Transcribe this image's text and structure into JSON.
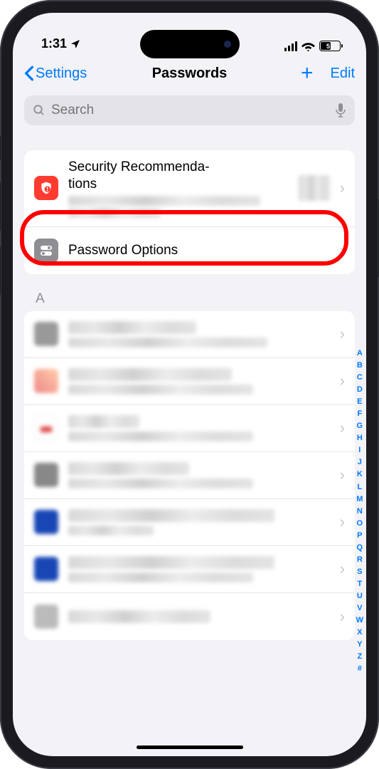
{
  "status": {
    "time": "1:31",
    "battery": "51"
  },
  "nav": {
    "back": "Settings",
    "title": "Passwords",
    "edit": "Edit"
  },
  "search": {
    "placeholder": "Search"
  },
  "rows": {
    "security": "Security Recommenda-\ntions",
    "options": "Password Options"
  },
  "sectionA": "A",
  "index": [
    "A",
    "B",
    "C",
    "D",
    "E",
    "F",
    "G",
    "H",
    "I",
    "J",
    "K",
    "L",
    "M",
    "N",
    "O",
    "P",
    "Q",
    "R",
    "S",
    "T",
    "U",
    "V",
    "W",
    "X",
    "Y",
    "Z",
    "#"
  ]
}
